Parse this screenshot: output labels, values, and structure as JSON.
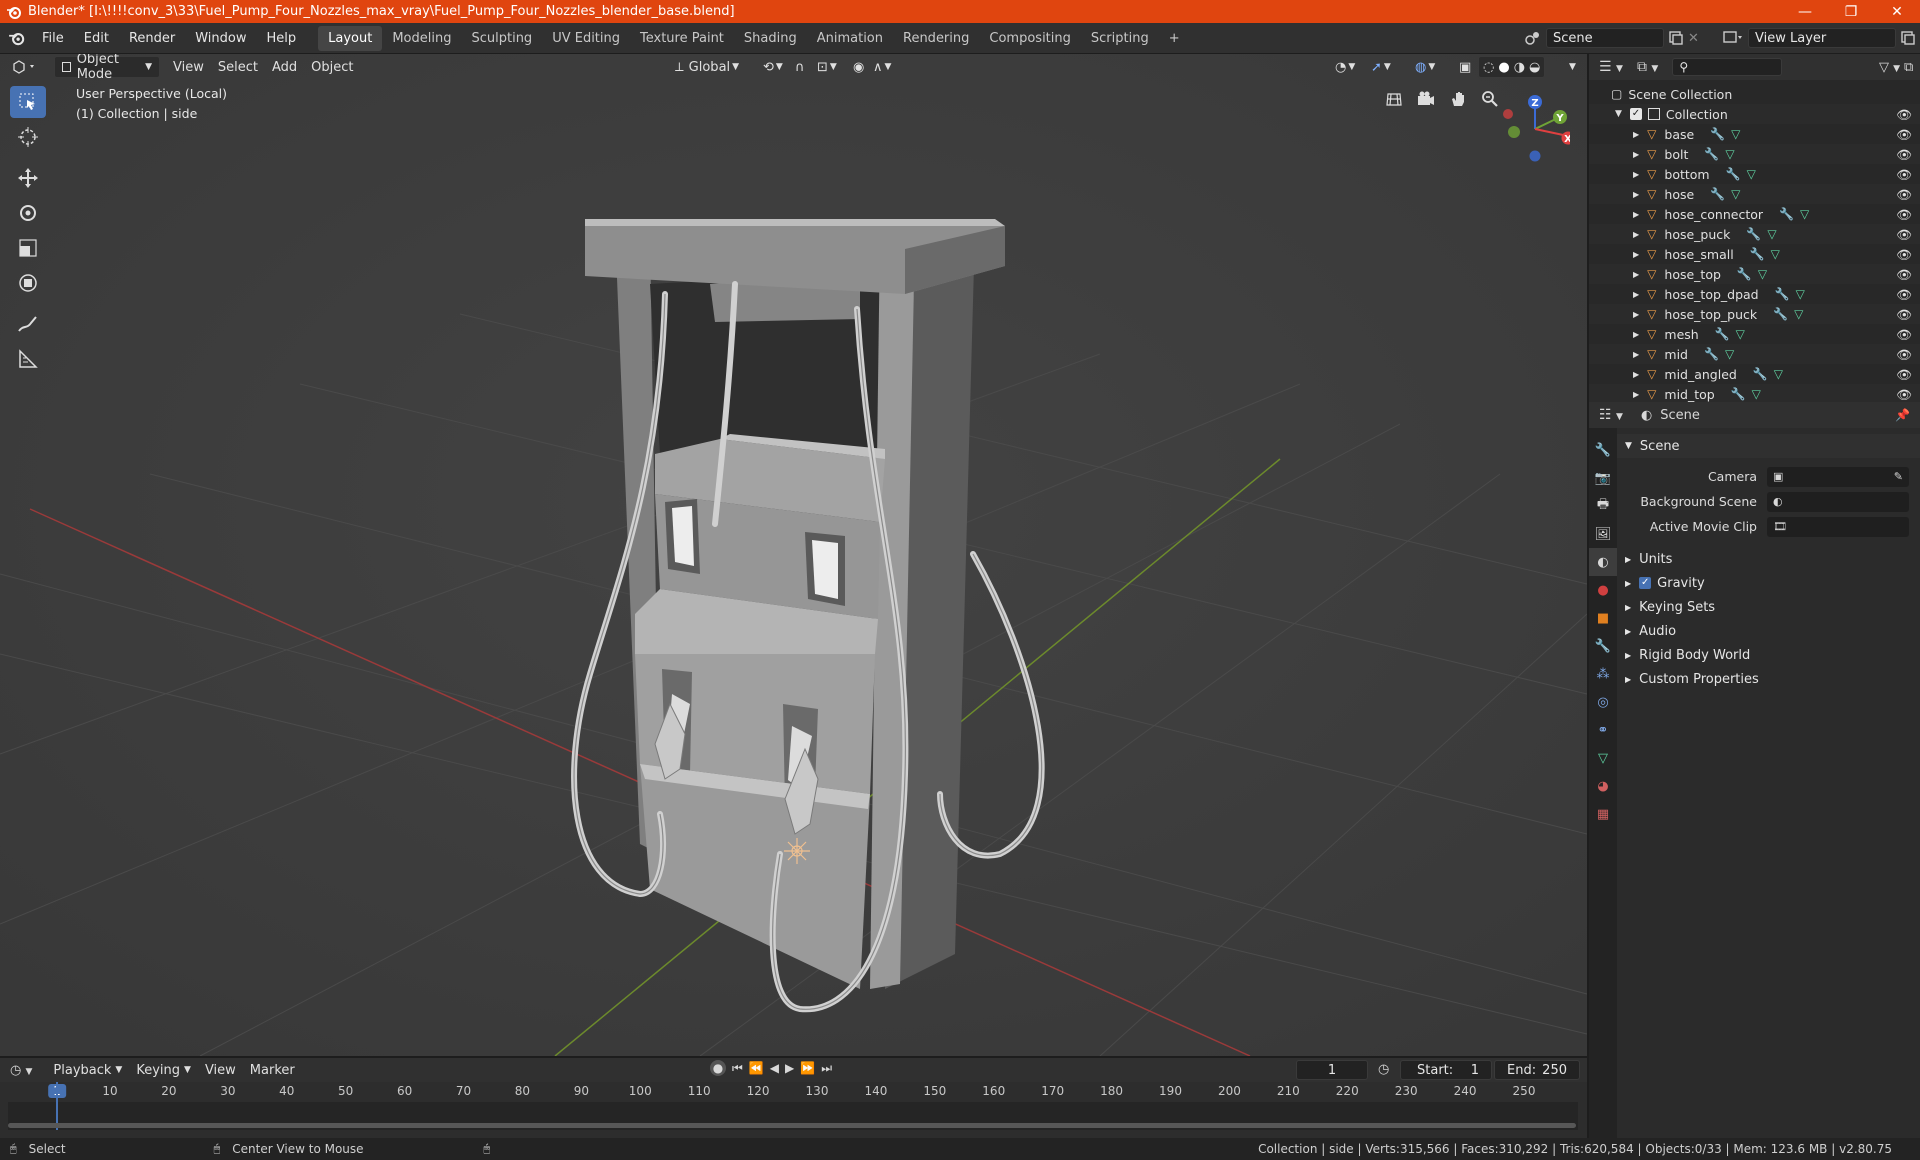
{
  "titlebar": {
    "title": "Blender* [I:\\!!!!conv_3\\33\\Fuel_Pump_Four_Nozzles_max_vray\\Fuel_Pump_Four_Nozzles_blender_base.blend]",
    "min": "—",
    "max": "❐",
    "close": "✕"
  },
  "menu": [
    "File",
    "Edit",
    "Render",
    "Window",
    "Help"
  ],
  "workspaces": [
    "Layout",
    "Modeling",
    "Sculpting",
    "UV Editing",
    "Texture Paint",
    "Shading",
    "Animation",
    "Rendering",
    "Compositing",
    "Scripting"
  ],
  "active_workspace": "Layout",
  "scene_name": "Scene",
  "view_layer": "View Layer",
  "viewport": {
    "mode": "Object Mode",
    "menus": [
      "View",
      "Select",
      "Add",
      "Object"
    ],
    "transform_orientation": "Global",
    "info_line1": "User Perspective (Local)",
    "info_line2": "(1) Collection | side",
    "gizmo_x": "X",
    "gizmo_y": "Y",
    "gizmo_z": "Z"
  },
  "outliner": {
    "root": "Scene Collection",
    "collection": "Collection",
    "objects": [
      "base",
      "bolt",
      "bottom",
      "hose",
      "hose_connector",
      "hose_puck",
      "hose_small",
      "hose_top",
      "hose_top_dpad",
      "hose_top_puck",
      "mesh",
      "mid",
      "mid_angled",
      "mid_top"
    ]
  },
  "properties": {
    "context": "Scene",
    "panel": "Scene",
    "camera_label": "Camera",
    "background_scene_label": "Background Scene",
    "active_movie_clip_label": "Active Movie Clip",
    "subpanels": [
      "Units",
      "Gravity",
      "Keying Sets",
      "Audio",
      "Rigid Body World",
      "Custom Properties"
    ]
  },
  "timeline": {
    "menus": [
      "Playback",
      "Keying",
      "View",
      "Marker"
    ],
    "current_frame": "1",
    "start_label": "Start:",
    "start": "1",
    "end_label": "End:",
    "end": "250",
    "ruler": [
      "1",
      "10",
      "20",
      "30",
      "40",
      "50",
      "60",
      "70",
      "80",
      "90",
      "100",
      "110",
      "120",
      "130",
      "140",
      "150",
      "160",
      "170",
      "180",
      "190",
      "200",
      "210",
      "220",
      "230",
      "240",
      "250"
    ]
  },
  "statusbar": {
    "left": "Select",
    "middle": "Center View to Mouse",
    "right": "Collection | side | Verts:315,566 | Faces:310,292 | Tris:620,584 | Objects:0/33 | Mem: 123.6 MB | v2.80.75"
  }
}
